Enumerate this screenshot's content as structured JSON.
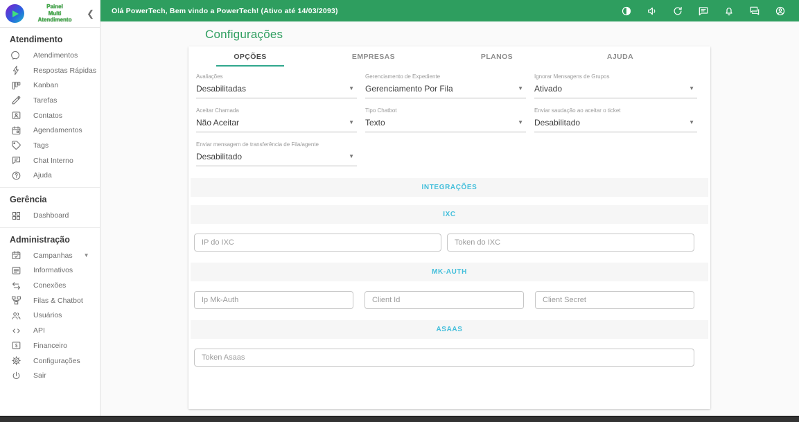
{
  "colors": {
    "primary_green": "#2e9e5f",
    "section_cyan": "#44bfdb",
    "tab_underline": "#30a78c"
  },
  "brand": {
    "line1": "Painel",
    "line2": "Multi",
    "line3": "Atendimento",
    "collapse": "❮"
  },
  "topbar": {
    "welcome_text": "Olá PowerTech, Bem vindo a PowerTech! (Ativo até 14/03/2093)",
    "icons": [
      "dark-mode",
      "volume",
      "refresh",
      "announcement",
      "notifications",
      "chat",
      "account"
    ]
  },
  "sidebar": {
    "sections": [
      {
        "header": "Atendimento",
        "items": [
          {
            "icon": "whatsapp-icon",
            "label": "Atendimentos"
          },
          {
            "icon": "bolt-icon",
            "label": "Respostas Rápidas"
          },
          {
            "icon": "kanban-icon",
            "label": "Kanban"
          },
          {
            "icon": "pencil-icon",
            "label": "Tarefas"
          },
          {
            "icon": "contacts-icon",
            "label": "Contatos"
          },
          {
            "icon": "calendar-icon",
            "label": "Agendamentos"
          },
          {
            "icon": "tag-icon",
            "label": "Tags"
          },
          {
            "icon": "chat-icon",
            "label": "Chat Interno"
          },
          {
            "icon": "help-icon",
            "label": "Ajuda"
          }
        ]
      },
      {
        "header": "Gerência",
        "items": [
          {
            "icon": "dashboard-icon",
            "label": "Dashboard"
          }
        ]
      },
      {
        "header": "Administração",
        "items": [
          {
            "icon": "campaign-calendar-icon",
            "label": "Campanhas",
            "expandable": true
          },
          {
            "icon": "news-icon",
            "label": "Informativos"
          },
          {
            "icon": "swap-icon",
            "label": "Conexões"
          },
          {
            "icon": "tree-icon",
            "label": "Filas & Chatbot"
          },
          {
            "icon": "users-icon",
            "label": "Usuários"
          },
          {
            "icon": "code-icon",
            "label": "API"
          },
          {
            "icon": "finance-icon",
            "label": "Financeiro"
          },
          {
            "icon": "gear-icon",
            "label": "Configurações"
          },
          {
            "icon": "power-icon",
            "label": "Sair"
          }
        ]
      }
    ]
  },
  "main": {
    "title": "Configurações",
    "tabs": [
      {
        "label": "OPÇÕES",
        "active": true
      },
      {
        "label": "EMPRESAS",
        "active": false
      },
      {
        "label": "PLANOS",
        "active": false
      },
      {
        "label": "AJUDA",
        "active": false
      }
    ],
    "selects": [
      {
        "label": "Avaliações",
        "value": "Desabilitadas"
      },
      {
        "label": "Gerenciamento de Expediente",
        "value": "Gerenciamento Por Fila"
      },
      {
        "label": "Ignorar Mensagens de Grupos",
        "value": "Ativado"
      },
      {
        "label": "Aceitar Chamada",
        "value": "Não Aceitar"
      },
      {
        "label": "Tipo Chatbot",
        "value": "Texto"
      },
      {
        "label": "Enviar saudação ao aceitar o ticket",
        "value": "Desabilitado"
      },
      {
        "label": "Enviar mensagem de transferência de Fila/agente",
        "value": "Desabilitado"
      }
    ],
    "sections": {
      "integracoes": "INTEGRAÇÕES",
      "ixc": "IXC",
      "mkauth": "MK-AUTH",
      "asaas": "ASAAS"
    },
    "inputs": {
      "ixc_ip": "IP do IXC",
      "ixc_token": "Token do IXC",
      "mk_ip": "Ip Mk-Auth",
      "mk_client_id": "Client Id",
      "mk_client_secret": "Client Secret",
      "asaas_token": "Token Asaas"
    }
  }
}
